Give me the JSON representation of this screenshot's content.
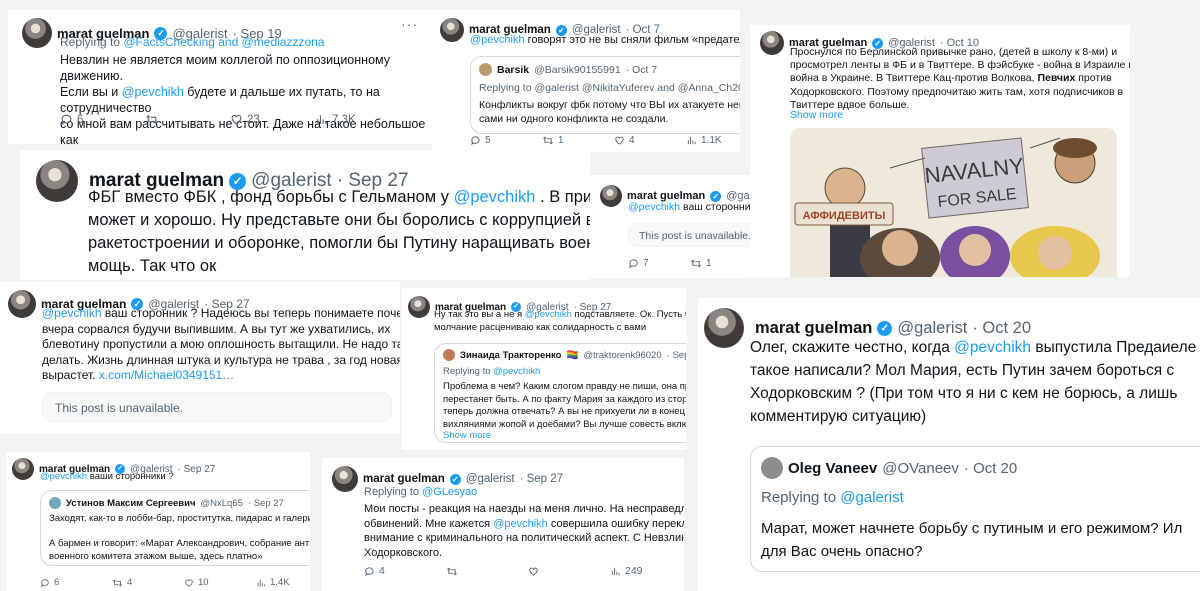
{
  "colors": {
    "link": "#1d9bf0",
    "verified": "#1d9bf0",
    "muted": "#536471"
  },
  "icons": {
    "reply": "reply-icon",
    "retweet": "retweet-icon",
    "like": "heart-icon",
    "views": "views-icon",
    "more": "more-icon"
  },
  "t1": {
    "name": "marat guelman",
    "handle": "@galerist",
    "date": "· Sep 19",
    "replying_prefix": "Replying to ",
    "replying_users": "@FactsChecking and @mediazzzona",
    "text_a": "Невзлин не является моим коллегой по оппозиционному движению.\nЕсли вы и ",
    "mention": "@pevchikh",
    "text_b": " будете и дальше их путать, то на сотрудничество\nсо мной вам рассчитывать не стоит. Даже на такое небольшое как\nоткровенный ответ на вопрос.",
    "replies": "6",
    "retweets": "",
    "likes": "23",
    "views": "7.3K"
  },
  "t2": {
    "name": "marat guelman",
    "handle": "@galerist",
    "date": "· Oct 7",
    "mention": "@pevchikh",
    "text": " говорят это не вы сняли фильм «предатели»",
    "q_name": "Barsik",
    "q_handle": "@Barsik90155991",
    "q_date": "· Oct 7",
    "q_replying": "Replying to @galerist @NikitaYuferev and @Anna_Ch2022",
    "q_text": "Конфликты вокруг фбк потому что ВЫ их атакуете непреры\nсами ни одного конфликта не создали.",
    "replies": "5",
    "retweets": "1",
    "likes": "4",
    "views": "1.1K"
  },
  "t3": {
    "name": "marat guelman",
    "handle": "@galerist",
    "date": "· Oct 10",
    "text_a": "Проснулся по Берлинской привычке рано, (детей в школу к 8-ми) и\nпросмотрел ленты в ФБ и в Твиттере. В фэйсбуке - война в Израиле и\nвойна в Украине. В Твиттере Кац-против Волкова, ",
    "bold": "Певчих",
    "text_b": " против\nХодорковского. Поэтому предпочитаю жить там, хотя подписчиков в\nТвиттере вдвое больше.",
    "show_more": "Show more",
    "image": {
      "banner_line1": "NAVALNY",
      "banner_line2": "FOR SALE",
      "sign": "АФФИДЕВИТЫ"
    }
  },
  "t4": {
    "name": "marat guelman",
    "handle": "@galerist",
    "date": "· Sep 27",
    "text_a": "ФБГ вместо ФБК , фонд борьбы с Гельманом у ",
    "mention": "@pevchikh",
    "text_b": " . В принци\nможет и хорошо. Ну представьте они бы боролись с коррупцией в\nракетостроении и оборонке, помогли бы Путину наращивать военн\nмощь. Так что ок"
  },
  "t5": {
    "name": "marat guelman",
    "handle": "@galeris",
    "date": "",
    "mention": "@pevchikh",
    "text": " ваш сторонник",
    "unavailable": "This post is unavailable.",
    "replies": "7",
    "retweets": "1"
  },
  "t6": {
    "name": "marat guelman",
    "handle": "@galerist",
    "date": "· Sep 27",
    "mention": "@pevchikh",
    "text": " ваш сторонник ? Надеюсь вы теперь понимаете почему\nвчера сорвался будучи выпившим. А вы тут же ухватились, их\nблевотину пропустили а мою оплошность вытащили. Не надо так\nделать. Жизнь длинная штука и культура не трава , за год новая не\nвырастет. ",
    "link": "x.com/Michael0349151…",
    "unavailable": "This post is unavailable."
  },
  "t7": {
    "name": "marat guelman",
    "handle": "@galerist",
    "date": "· Sep 27",
    "text_a": "Ну так это вы а не я ",
    "mention": "@pevchikh",
    "text_b": " подставляете. Ок. Пусть буд\nмолчание расцениваю как солидарность с вами",
    "q_name": "Зинаида Тракторенко",
    "q_flag": "🏳️‍🌈",
    "q_handle": "@traktorenk96020",
    "q_date": "· Sep",
    "q_replying_prefix": "Replying to ",
    "q_replying_user": "@pevchikh",
    "q_text": "Проблема в чем? Каким слогом правду не пиши, она прав\nперестанет быть. А по факту Мария за каждого из сторон\nтеперь должна отвечать? А вы не прихуели ли в конец со\nвихляниями жопой и доебами? Вы лучше совесть включи",
    "show_more": "Show more"
  },
  "t8": {
    "name": "marat guelman",
    "handle": "@galerist",
    "date": "· Oct 20",
    "text_a": "Олег, скажите честно, когда ",
    "mention": "@pevchikh",
    "text_b": " выпустила Предаиеле\nтакое написали? Мол Мария, есть Путин зачем бороться с\nХодорковским ? (При том что я ни с кем не борюсь, а лишь\nкомментирую ситуацию)",
    "q_name": "Oleg Vaneev",
    "q_handle": "@OVaneev",
    "q_date": "· Oct 20",
    "q_replying_prefix": "Replying to ",
    "q_replying_user": "@galerist",
    "q_text": "Марат, может начнете борьбу с путиным и его режимом? Ил\nдля Вас очень опасно?"
  },
  "t9": {
    "name": "marat guelman",
    "handle": "@galerist",
    "date": "· Sep 27",
    "mention": "@pevchikh",
    "text": " ваши сторонники ?",
    "q_name": "Устинов Максим Сергеевич",
    "q_handle": "@NxLq65",
    "q_date": "· Sep 27",
    "q_text": "Заходят, как-то в лобби-бар, проститутка, пидарас и галери\n\nА бармен и говорит: «Марат Александрович, собрание анти\nвоенного комитета этажом выше, здесь платно»",
    "replies": "6",
    "retweets": "4",
    "likes": "10",
    "views": "1.4K"
  },
  "t10": {
    "name": "marat guelman",
    "handle": "@galerist",
    "date": "· Sep 27",
    "replying_prefix": "Replying to ",
    "replying_user": "@GLesyao",
    "text_a": "Мои посты - реакция на наезды на меня лично. На несправедливо\nобвинений. Мне кажется ",
    "mention": "@pevchikh",
    "text_b": " совершила ошибку перекл\nвнимание с криминального на политический аспект. С Невзлин\nХодорковского.",
    "replies": "4",
    "retweets": "",
    "likes": "",
    "views": "249"
  }
}
